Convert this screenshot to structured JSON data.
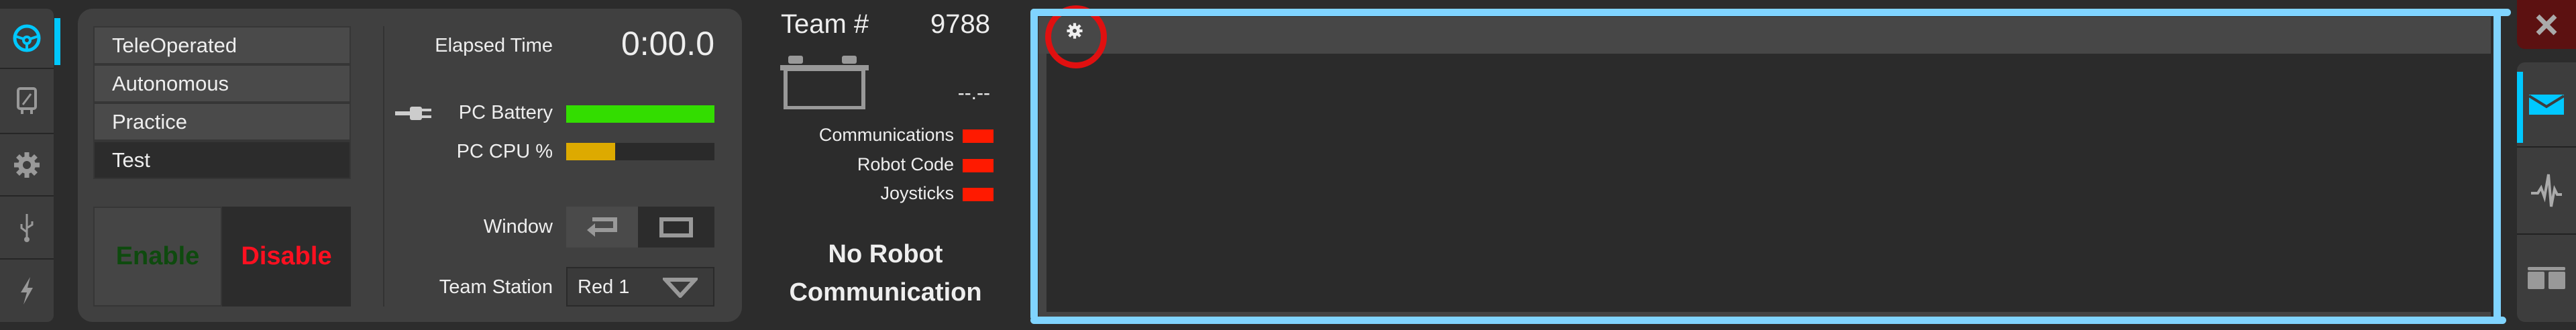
{
  "left_tabs": [
    {
      "name": "operation",
      "icon": "steering-wheel-icon",
      "active": true
    },
    {
      "name": "diagnostics",
      "icon": "meter-icon"
    },
    {
      "name": "setup",
      "icon": "gear-icon"
    },
    {
      "name": "usb-devices",
      "icon": "usb-icon"
    },
    {
      "name": "power",
      "icon": "lightning-icon"
    }
  ],
  "modes": [
    "TeleOperated",
    "Autonomous",
    "Practice",
    "Test"
  ],
  "selected_mode": "Test",
  "enable_label": "Enable",
  "disable_label": "Disable",
  "elapsed_label": "Elapsed Time",
  "elapsed_value": "0:00.0",
  "pc_battery_label": "PC Battery",
  "pc_battery_percent": 100,
  "pc_cpu_label": "PC CPU %",
  "pc_cpu_percent": 33,
  "window_label": "Window",
  "team_station_label": "Team Station",
  "team_station_value": "Red 1",
  "team_label": "Team #",
  "team_number": "9788",
  "battery_voltage": "--.--",
  "status": [
    {
      "label": "Communications",
      "color": "#ff1a00"
    },
    {
      "label": "Robot Code",
      "color": "#ff1a00"
    },
    {
      "label": "Joysticks",
      "color": "#ff1a00"
    }
  ],
  "message_line1": "No Robot",
  "message_line2": "Communication",
  "colors": {
    "accent": "#00c8ff",
    "battery": "#33dd00",
    "cpu": "#ddaa00",
    "highlight": "#80d4ff",
    "annotation": "#e01010"
  },
  "right_tabs": [
    {
      "name": "messages",
      "icon": "envelope-icon",
      "active": true
    },
    {
      "name": "charts",
      "icon": "pulse-icon"
    },
    {
      "name": "both",
      "icon": "split-view-icon"
    }
  ]
}
